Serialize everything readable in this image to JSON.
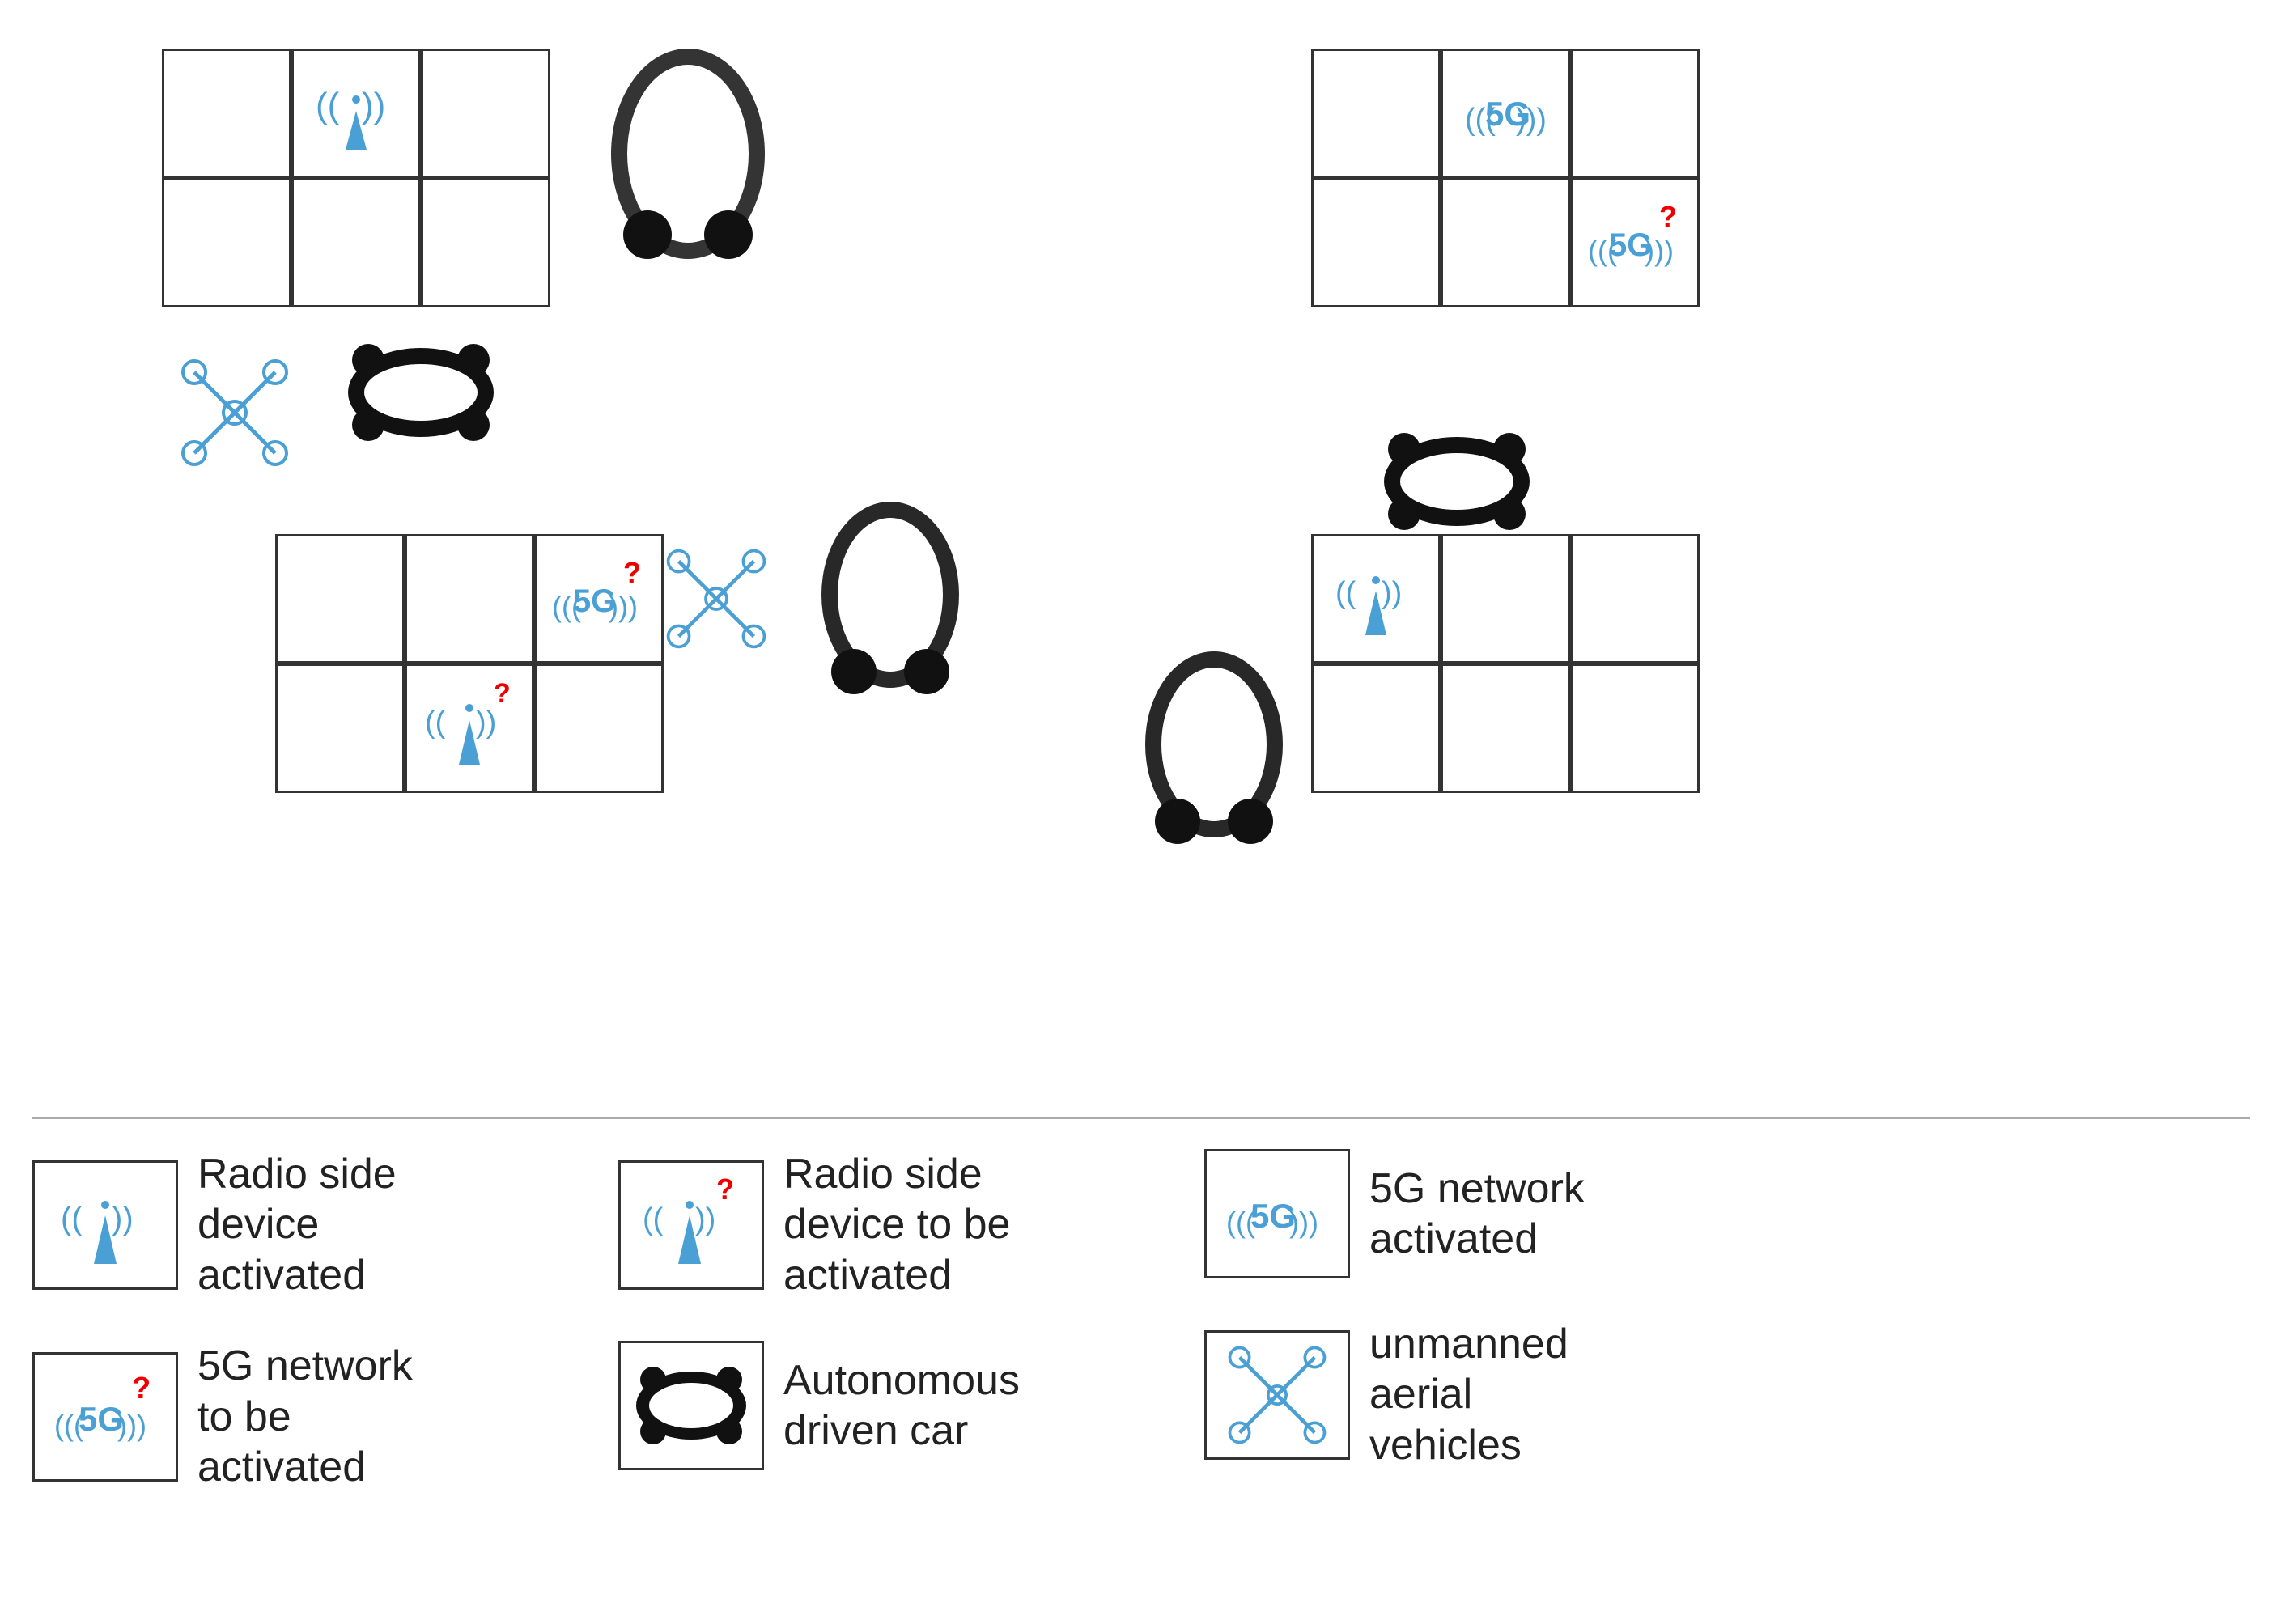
{
  "legend": {
    "items": [
      {
        "id": "radio-activated",
        "label": "Radio side device activated"
      },
      {
        "id": "radio-to-activate",
        "label": "Radio side device to be activated"
      },
      {
        "id": "5g-activated",
        "label": "5G network activated"
      },
      {
        "id": "5g-to-activate",
        "label": "5G network to be activated"
      },
      {
        "id": "car",
        "label": "Autonomous driven car"
      },
      {
        "id": "drone",
        "label": "unmanned aerial vehicles"
      }
    ]
  },
  "colors": {
    "blue": "#4a9fd4",
    "black": "#222",
    "red": "#e00",
    "border": "#333"
  }
}
